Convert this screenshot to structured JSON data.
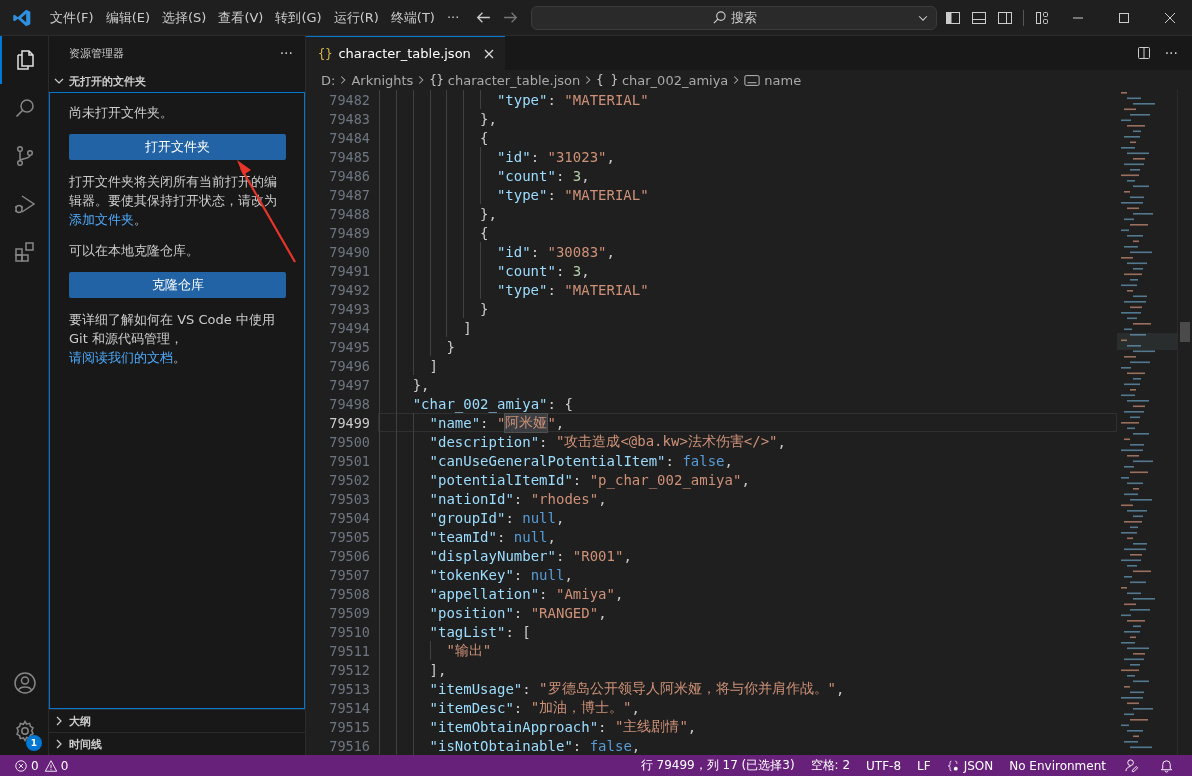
{
  "window": {
    "menu": [
      "文件(F)",
      "编辑(E)",
      "选择(S)",
      "查看(V)",
      "转到(G)",
      "运行(R)",
      "终端(T)"
    ],
    "menu_more": "···",
    "search": {
      "placeholder": "搜索"
    }
  },
  "activity_bar": [
    {
      "kind": "explorer",
      "selected": true
    },
    {
      "kind": "search",
      "selected": false
    },
    {
      "kind": "source-control",
      "selected": false
    },
    {
      "kind": "run-debug",
      "selected": false
    },
    {
      "kind": "extensions",
      "selected": false
    }
  ],
  "settings_badge": "1",
  "sidebar": {
    "title": "资源管理器",
    "more": "···",
    "section": {
      "title": "无打开的文件夹",
      "expanded": true
    },
    "message": "尚未打开文件夹。",
    "open_button": "打开文件夹",
    "paragraph_1": {
      "text": "打开文件夹将关闭所有当前打开的编辑器。要使其保持打开状态，请改为",
      "link": "添加文件夹",
      "end": "。"
    },
    "message_2": "可以在本地克隆仓库。",
    "clone_button": "克隆仓库",
    "paragraph_2": {
      "text": "要详细了解如何在 VS Code 中使用 Git 和源代码管理，",
      "link": "请阅读我们的文档",
      "end": "。"
    },
    "collapsed_sections": [
      {
        "title": "大纲",
        "expanded": false
      },
      {
        "title": "时间线",
        "expanded": false
      }
    ]
  },
  "editor": {
    "tab": {
      "icon": "{}",
      "title": "character_table.json",
      "selected": true
    },
    "more": "···",
    "breadcrumb": [
      {
        "kind": "text",
        "text": "D:"
      },
      {
        "kind": "text",
        "text": "Arknights"
      },
      {
        "kind": "braces",
        "icon": "{}",
        "text": "character_table.json"
      },
      {
        "kind": "braces",
        "icon": "{ }",
        "text": "char_002_amiya"
      },
      {
        "kind": "string",
        "text": "name"
      }
    ],
    "lines": [
      {
        "n": "79482",
        "current": false,
        "tokens": [
          {
            "kind": "key",
            "text": "              \"type\""
          },
          {
            "kind": "punct",
            "text": ": "
          },
          {
            "kind": "str",
            "text": "\"MATERIAL\""
          }
        ]
      },
      {
        "n": "79483",
        "current": false,
        "tokens": [
          {
            "kind": "punct",
            "text": "            },"
          }
        ]
      },
      {
        "n": "79484",
        "current": false,
        "tokens": [
          {
            "kind": "punct",
            "text": "            {"
          }
        ]
      },
      {
        "n": "79485",
        "current": false,
        "tokens": [
          {
            "kind": "key",
            "text": "              \"id\""
          },
          {
            "kind": "punct",
            "text": ": "
          },
          {
            "kind": "str",
            "text": "\"31023\""
          },
          {
            "kind": "punct",
            "text": ","
          }
        ]
      },
      {
        "n": "79486",
        "current": false,
        "tokens": [
          {
            "kind": "key",
            "text": "              \"count\""
          },
          {
            "kind": "punct",
            "text": ": "
          },
          {
            "kind": "num",
            "text": "3"
          },
          {
            "kind": "punct",
            "text": ","
          }
        ]
      },
      {
        "n": "79487",
        "current": false,
        "tokens": [
          {
            "kind": "key",
            "text": "              \"type\""
          },
          {
            "kind": "punct",
            "text": ": "
          },
          {
            "kind": "str",
            "text": "\"MATERIAL\""
          }
        ]
      },
      {
        "n": "79488",
        "current": false,
        "tokens": [
          {
            "kind": "punct",
            "text": "            },"
          }
        ]
      },
      {
        "n": "79489",
        "current": false,
        "tokens": [
          {
            "kind": "punct",
            "text": "            {"
          }
        ]
      },
      {
        "n": "79490",
        "current": false,
        "tokens": [
          {
            "kind": "key",
            "text": "              \"id\""
          },
          {
            "kind": "punct",
            "text": ": "
          },
          {
            "kind": "str",
            "text": "\"30083\""
          },
          {
            "kind": "punct",
            "text": ","
          }
        ]
      },
      {
        "n": "79491",
        "current": false,
        "tokens": [
          {
            "kind": "key",
            "text": "              \"count\""
          },
          {
            "kind": "punct",
            "text": ": "
          },
          {
            "kind": "num",
            "text": "3"
          },
          {
            "kind": "punct",
            "text": ","
          }
        ]
      },
      {
        "n": "79492",
        "current": false,
        "tokens": [
          {
            "kind": "key",
            "text": "              \"type\""
          },
          {
            "kind": "punct",
            "text": ": "
          },
          {
            "kind": "str",
            "text": "\"MATERIAL\""
          }
        ]
      },
      {
        "n": "79493",
        "current": false,
        "tokens": [
          {
            "kind": "punct",
            "text": "            }"
          }
        ]
      },
      {
        "n": "79494",
        "current": false,
        "tokens": [
          {
            "kind": "punct",
            "text": "          ]"
          }
        ]
      },
      {
        "n": "79495",
        "current": false,
        "tokens": [
          {
            "kind": "punct",
            "text": "        }"
          }
        ]
      },
      {
        "n": "79496",
        "current": false,
        "tokens": [
          {
            "kind": "punct",
            "text": "      ]"
          }
        ]
      },
      {
        "n": "79497",
        "current": false,
        "tokens": [
          {
            "kind": "punct",
            "text": "    },"
          }
        ]
      },
      {
        "n": "79498",
        "current": false,
        "tokens": [
          {
            "kind": "key",
            "text": "    \"char_002_amiya\""
          },
          {
            "kind": "punct",
            "text": ": {"
          }
        ]
      },
      {
        "n": "79499",
        "current": true,
        "tokens": [
          {
            "kind": "key",
            "text": "      \"name\""
          },
          {
            "kind": "punct",
            "text": ": "
          },
          {
            "kind": "str",
            "text": "\""
          },
          {
            "kind": "selected-str",
            "text": "阿米娅"
          },
          {
            "kind": "str",
            "text": "\""
          },
          {
            "kind": "punct",
            "text": ","
          }
        ]
      },
      {
        "n": "79500",
        "current": false,
        "tokens": [
          {
            "kind": "key",
            "text": "      \"description\""
          },
          {
            "kind": "punct",
            "text": ": "
          },
          {
            "kind": "str",
            "text": "\"攻击造成<@ba.kw>法术伤害</>\""
          },
          {
            "kind": "punct",
            "text": ","
          }
        ]
      },
      {
        "n": "79501",
        "current": false,
        "tokens": [
          {
            "kind": "key",
            "text": "      \"canUseGeneralPotentialItem\""
          },
          {
            "kind": "punct",
            "text": ": "
          },
          {
            "kind": "kw",
            "text": "false"
          },
          {
            "kind": "punct",
            "text": ","
          }
        ]
      },
      {
        "n": "79502",
        "current": false,
        "tokens": [
          {
            "kind": "key",
            "text": "      \"potentialItemId\""
          },
          {
            "kind": "punct",
            "text": ": "
          },
          {
            "kind": "str",
            "text": "\"p_char_002_amiya\""
          },
          {
            "kind": "punct",
            "text": ","
          }
        ]
      },
      {
        "n": "79503",
        "current": false,
        "tokens": [
          {
            "kind": "key",
            "text": "      \"nationId\""
          },
          {
            "kind": "punct",
            "text": ": "
          },
          {
            "kind": "str",
            "text": "\"rhodes\""
          },
          {
            "kind": "punct",
            "text": ","
          }
        ]
      },
      {
        "n": "79504",
        "current": false,
        "tokens": [
          {
            "kind": "key",
            "text": "      \"groupId\""
          },
          {
            "kind": "punct",
            "text": ": "
          },
          {
            "kind": "kw",
            "text": "null"
          },
          {
            "kind": "punct",
            "text": ","
          }
        ]
      },
      {
        "n": "79505",
        "current": false,
        "tokens": [
          {
            "kind": "key",
            "text": "      \"teamId\""
          },
          {
            "kind": "punct",
            "text": ": "
          },
          {
            "kind": "kw",
            "text": "null"
          },
          {
            "kind": "punct",
            "text": ","
          }
        ]
      },
      {
        "n": "79506",
        "current": false,
        "tokens": [
          {
            "kind": "key",
            "text": "      \"displayNumber\""
          },
          {
            "kind": "punct",
            "text": ": "
          },
          {
            "kind": "str",
            "text": "\"R001\""
          },
          {
            "kind": "punct",
            "text": ","
          }
        ]
      },
      {
        "n": "79507",
        "current": false,
        "tokens": [
          {
            "kind": "key",
            "text": "      \"tokenKey\""
          },
          {
            "kind": "punct",
            "text": ": "
          },
          {
            "kind": "kw",
            "text": "null"
          },
          {
            "kind": "punct",
            "text": ","
          }
        ]
      },
      {
        "n": "79508",
        "current": false,
        "tokens": [
          {
            "kind": "key",
            "text": "      \"appellation\""
          },
          {
            "kind": "punct",
            "text": ": "
          },
          {
            "kind": "str",
            "text": "\"Amiya\""
          },
          {
            "kind": "punct",
            "text": ","
          }
        ]
      },
      {
        "n": "79509",
        "current": false,
        "tokens": [
          {
            "kind": "key",
            "text": "      \"position\""
          },
          {
            "kind": "punct",
            "text": ": "
          },
          {
            "kind": "str",
            "text": "\"RANGED\""
          },
          {
            "kind": "punct",
            "text": ","
          }
        ]
      },
      {
        "n": "79510",
        "current": false,
        "tokens": [
          {
            "kind": "key",
            "text": "      \"tagList\""
          },
          {
            "kind": "punct",
            "text": ": ["
          }
        ]
      },
      {
        "n": "79511",
        "current": false,
        "tokens": [
          {
            "kind": "str",
            "text": "        \"输出\""
          }
        ]
      },
      {
        "n": "79512",
        "current": false,
        "tokens": [
          {
            "kind": "punct",
            "text": "      ],"
          }
        ]
      },
      {
        "n": "79513",
        "current": false,
        "tokens": [
          {
            "kind": "key",
            "text": "      \"itemUsage\""
          },
          {
            "kind": "punct",
            "text": ": "
          },
          {
            "kind": "str",
            "text": "\"罗德岛公开领导人阿米娅，将与你并肩作战。\""
          },
          {
            "kind": "punct",
            "text": ","
          }
        ]
      },
      {
        "n": "79514",
        "current": false,
        "tokens": [
          {
            "kind": "key",
            "text": "      \"itemDesc\""
          },
          {
            "kind": "punct",
            "text": ": "
          },
          {
            "kind": "str",
            "text": "\"加油，博士。\""
          },
          {
            "kind": "punct",
            "text": ","
          }
        ]
      },
      {
        "n": "79515",
        "current": false,
        "tokens": [
          {
            "kind": "key",
            "text": "      \"itemObtainApproach\""
          },
          {
            "kind": "punct",
            "text": ": "
          },
          {
            "kind": "str",
            "text": "\"主线剧情\""
          },
          {
            "kind": "punct",
            "text": ","
          }
        ]
      },
      {
        "n": "79516",
        "current": false,
        "tokens": [
          {
            "kind": "key",
            "text": "      \"isNotObtainable\""
          },
          {
            "kind": "punct",
            "text": ": "
          },
          {
            "kind": "kw",
            "text": "false"
          },
          {
            "kind": "punct",
            "text": ","
          }
        ]
      }
    ]
  },
  "status_bar": {
    "errors": "0",
    "warnings": "0",
    "items": [
      {
        "kind": "text",
        "text": "行 79499，列 17 (已选择3)"
      },
      {
        "kind": "text",
        "text": "空格: 2"
      },
      {
        "kind": "text",
        "text": "UTF-8"
      },
      {
        "kind": "text",
        "text": "LF"
      },
      {
        "kind": "language",
        "text": "JSON"
      },
      {
        "kind": "text",
        "text": "No Environment"
      },
      {
        "kind": "feedback"
      },
      {
        "kind": "bell"
      }
    ]
  }
}
